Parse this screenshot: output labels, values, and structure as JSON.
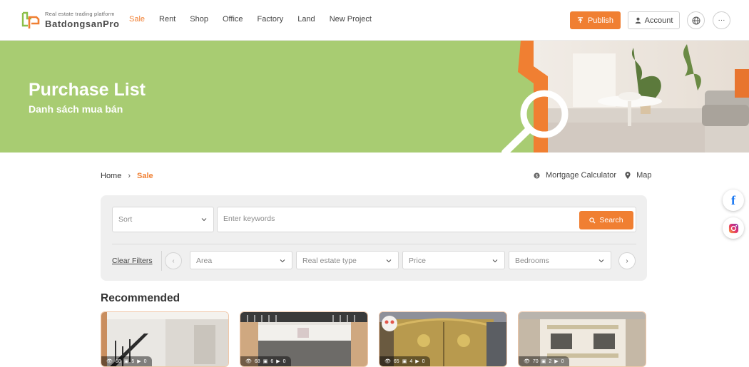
{
  "header": {
    "logo_tagline": "Real estate trading platform",
    "logo_name": "BatdongsanPro",
    "nav": [
      {
        "label": "Sale",
        "active": true
      },
      {
        "label": "Rent",
        "active": false
      },
      {
        "label": "Shop",
        "active": false
      },
      {
        "label": "Office",
        "active": false
      },
      {
        "label": "Factory",
        "active": false
      },
      {
        "label": "Land",
        "active": false
      },
      {
        "label": "New Project",
        "active": false
      }
    ],
    "publish_label": "Publish",
    "account_label": "Account",
    "more_label": "···"
  },
  "banner": {
    "title": "Purchase List",
    "subtitle": "Danh sách mua bán"
  },
  "breadcrumb": {
    "home": "Home",
    "current": "Sale"
  },
  "tools": {
    "mortgage": "Mortgage Calculator",
    "map": "Map"
  },
  "filters": {
    "sort_label": "Sort",
    "search_placeholder": "Enter keywords",
    "search_button": "Search",
    "clear_label": "Clear Filters",
    "dropdowns": [
      "Area",
      "Real estate type",
      "Price",
      "Bedrooms"
    ]
  },
  "recommended": {
    "title": "Recommended",
    "cards": [
      {
        "views": "68",
        "photos": "5",
        "videos": "0"
      },
      {
        "views": "68",
        "photos": "6",
        "videos": "0"
      },
      {
        "views": "65",
        "photos": "4",
        "videos": "0"
      },
      {
        "views": "70",
        "photos": "2",
        "videos": "0"
      }
    ]
  },
  "colors": {
    "accent": "#f07f32",
    "banner_green": "#a8cc72",
    "panel_bg": "#efefef"
  },
  "social": [
    "facebook-icon",
    "instagram-icon"
  ]
}
